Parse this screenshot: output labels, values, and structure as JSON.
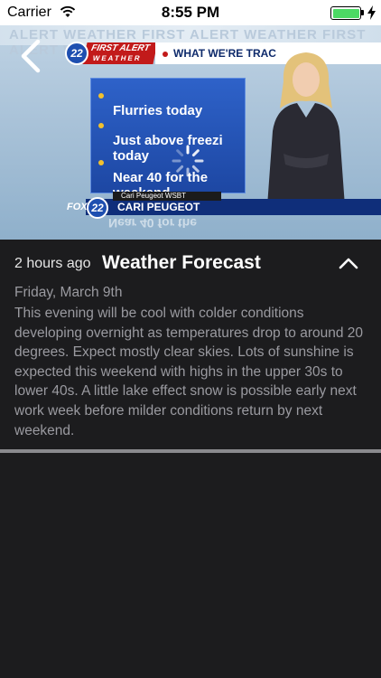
{
  "status_bar": {
    "carrier": "Carrier",
    "time": "8:55 PM",
    "battery_level": 1.0,
    "battery_color": "#4cd964"
  },
  "video": {
    "back_icon": "chevron-left-icon",
    "banner_ghost": "ALERT WEATHER  FIRST ALERT WEATHER  FIRST ALERT WEATHER  FIRST AL",
    "logo_number": "22",
    "first_alert_top": "FIRST ALERT",
    "first_alert_bottom": "WEATHER",
    "tracking_label": "WHAT WE'RE TRAC",
    "board_items": [
      "Flurries today",
      "Just above freezi\ntoday",
      "Near 40 for the\nweekend"
    ],
    "lower_third_sub": "Cari Peugeot WSBT",
    "lower_third_name": "CARI PEUGEOT",
    "fox_label": "FOX",
    "fox_number": "22",
    "mirror_text": "Near 40 for the",
    "loading_icon": "loading-spinner-icon"
  },
  "article": {
    "time_ago": "2 hours ago",
    "title": "Weather Forecast",
    "collapse_icon": "chevron-up-icon",
    "date": "Friday, March 9th",
    "body": "This evening will be cool with colder conditions developing overnight as temperatures drop to around 20 degrees. Expect mostly clear skies. Lots of sunshine is expected this weekend with highs in the upper 30s to lower 40s. A little lake effect snow is possible early next work week before milder conditions return by next weekend."
  },
  "colors": {
    "background": "#1c1c1e",
    "divider": "#8a8a8e",
    "brand_blue": "#1e4fb0",
    "alert_red": "#c21a1a"
  }
}
